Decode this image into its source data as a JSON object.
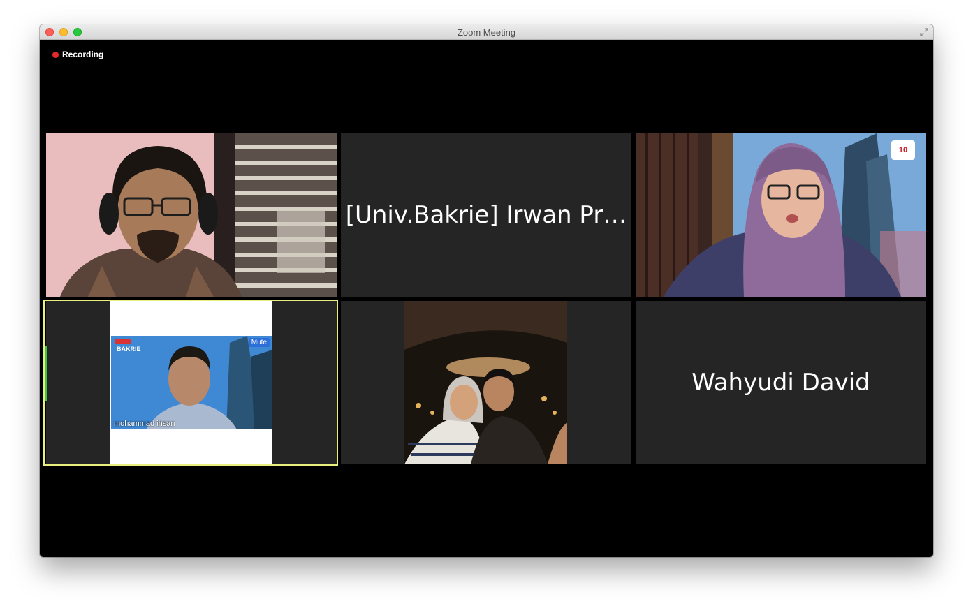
{
  "window": {
    "title": "Zoom Meeting"
  },
  "recording": {
    "label": "Recording",
    "dot_color": "#e5292a"
  },
  "participants": [
    {
      "type": "video",
      "description_icon": "participant-video-man-headphones"
    },
    {
      "type": "name",
      "name": "[Univ.Bakrie] Irwan Pr…"
    },
    {
      "type": "video",
      "description_icon": "participant-video-woman-hijab"
    },
    {
      "type": "video-shared",
      "inner_name": "mohammad ihsan",
      "inner_mute": "Mute",
      "inner_logo": "BAKRIE",
      "active_speaker": true
    },
    {
      "type": "video",
      "description_icon": "participant-video-couple-selfie"
    },
    {
      "type": "name",
      "name": "Wahyudi David"
    }
  ],
  "colors": {
    "tile_bg": "#252525",
    "active_border": "#e9ef7e",
    "window_bg": "#000000"
  }
}
